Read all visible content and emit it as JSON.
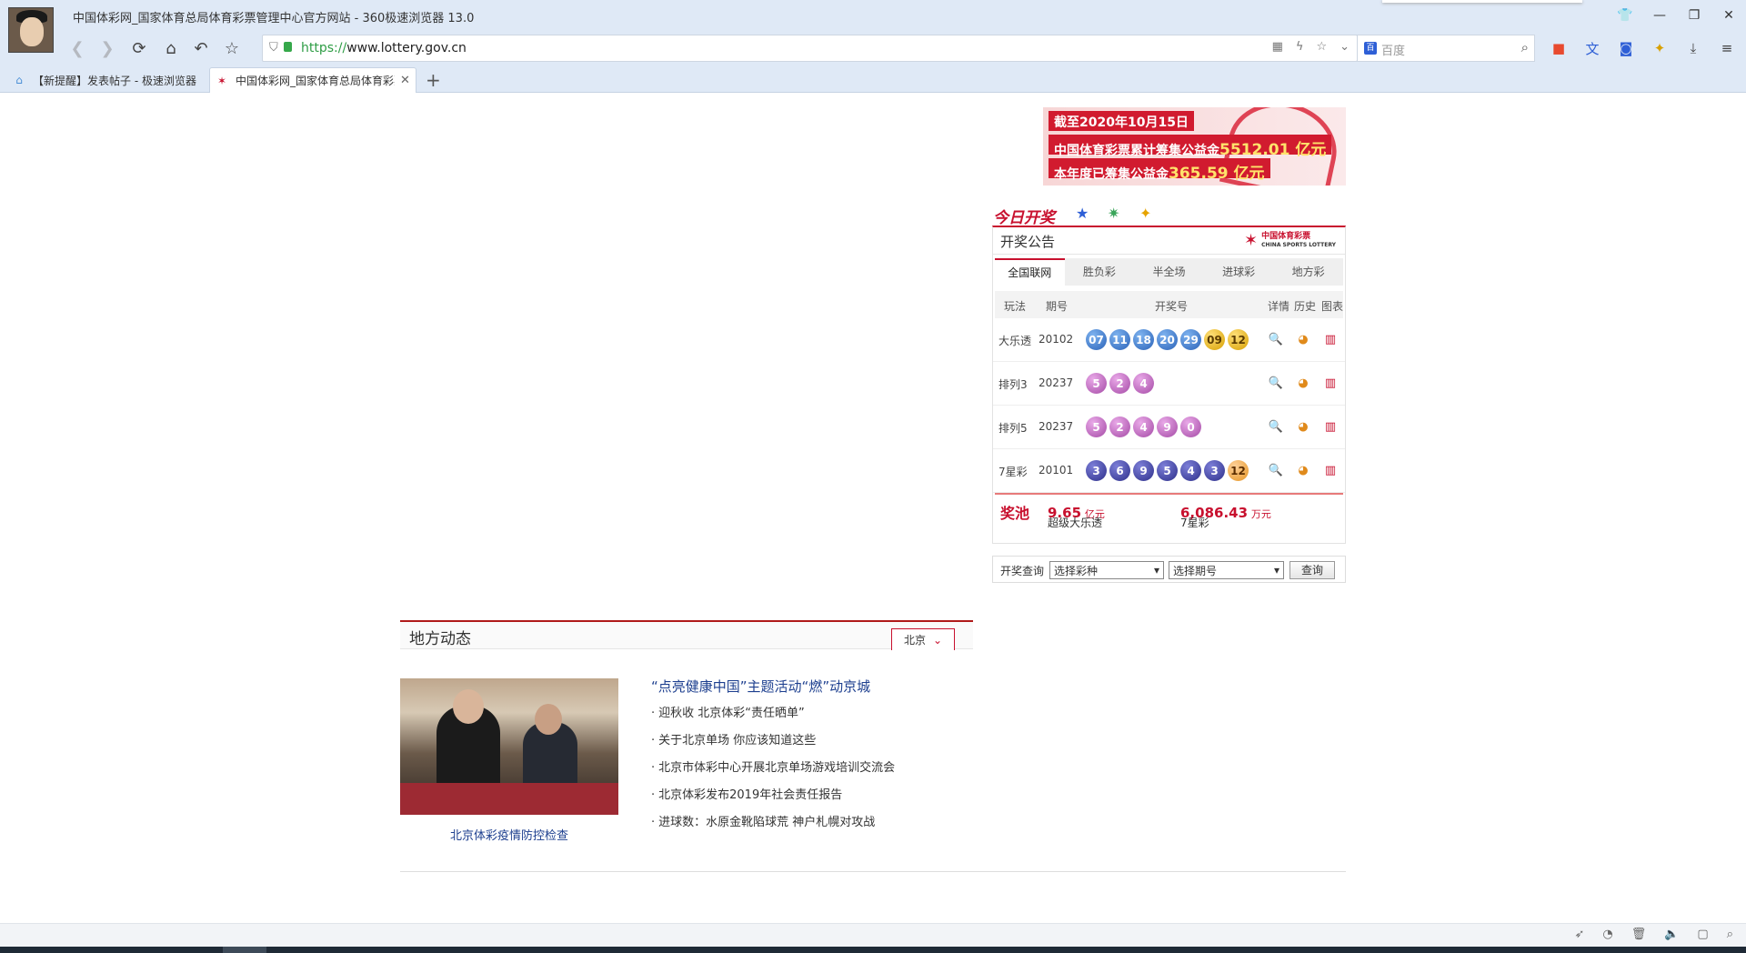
{
  "window": {
    "title": "中国体彩网_国家体育总局体育彩票管理中心官方网站 - 360极速浏览器 13.0"
  },
  "toolbar": {
    "url_scheme": "https://",
    "url_host": "www.lottery.gov.cn",
    "search_placeholder": "百度"
  },
  "tabs": [
    {
      "label": "【新提醒】发表帖子 - 极速浏览器"
    },
    {
      "label": "中国体彩网_国家体育总局体育彩票管理中心官方网站"
    }
  ],
  "banner": {
    "line1": "截至2020年10月15日",
    "line2_prefix": "中国体育彩票累计筹集公益金",
    "line2_value": "5512.01 亿元",
    "line3_prefix": "本年度已筹集公益金",
    "line3_value": "365.59 亿元"
  },
  "today": {
    "title": "今日开奖",
    "game_icons": [
      "大乐透",
      "排列5",
      "7星彩"
    ]
  },
  "announce": {
    "title": "开奖公告",
    "logo_text": "中国体育彩票",
    "logo_sub": "CHINA SPORTS LOTTERY",
    "tabs": [
      "全国联网",
      "胜负彩",
      "半全场",
      "进球彩",
      "地方彩"
    ],
    "active_tab": 0,
    "headers": {
      "game": "玩法",
      "issue": "期号",
      "numbers": "开奖号",
      "detail": "详情",
      "history": "历史",
      "chart": "图表"
    },
    "rows": [
      {
        "game": "大乐透",
        "issue": "20102",
        "balls": [
          "07",
          "11",
          "18",
          "20",
          "29",
          "09",
          "12"
        ],
        "colors": [
          "blue",
          "blue",
          "blue",
          "blue",
          "blue",
          "gold",
          "gold"
        ]
      },
      {
        "game": "排列3",
        "issue": "20237",
        "balls": [
          "5",
          "2",
          "4"
        ],
        "colors": [
          "pink",
          "pink",
          "pink"
        ]
      },
      {
        "game": "排列5",
        "issue": "20237",
        "balls": [
          "5",
          "2",
          "4",
          "9",
          "0"
        ],
        "colors": [
          "pink",
          "pink",
          "pink",
          "pink",
          "pink"
        ]
      },
      {
        "game": "7星彩",
        "issue": "20101",
        "balls": [
          "3",
          "6",
          "9",
          "5",
          "4",
          "3",
          "12"
        ],
        "colors": [
          "navy",
          "navy",
          "navy",
          "navy",
          "navy",
          "navy",
          "orange"
        ]
      }
    ],
    "pool": {
      "label": "奖池",
      "dlt_name": "超级大乐透",
      "dlt_value": "9.65",
      "dlt_unit": "亿元",
      "qxc_name": "7星彩",
      "qxc_value": "6,086.43",
      "qxc_unit": "万元"
    }
  },
  "query": {
    "label": "开奖查询",
    "select_game": "选择彩种",
    "select_issue": "选择期号",
    "button": "查询"
  },
  "local": {
    "title": "地方动态",
    "city": "北京",
    "photo_caption": "北京体彩疫情防控检查",
    "headline": "“点亮健康中国”主题活动“燃”动京城",
    "items": [
      "迎秋收 北京体彩“责任晒单”",
      "关于北京单场 你应该知道这些",
      "北京市体彩中心开展北京单场游戏培训交流会",
      "北京体彩发布2019年社会责任报告",
      "进球数：水原金靴陷球荒 神户札幌对攻战"
    ]
  },
  "colors": {
    "brand_red": "#c8102e",
    "link_blue": "#1d3f8f",
    "secure_green": "#2e9d45"
  }
}
